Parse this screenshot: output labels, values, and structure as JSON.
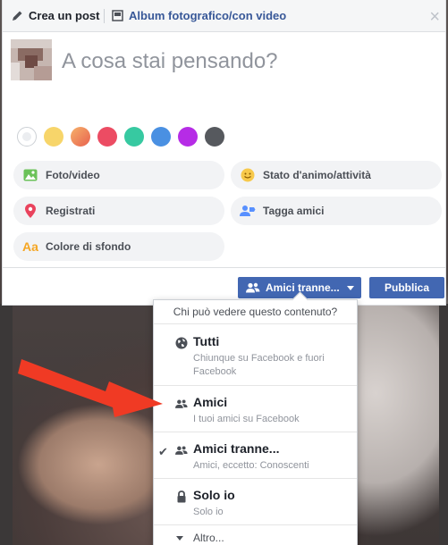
{
  "topbar": {
    "create_post_label": "Crea un post",
    "album_label": "Album fotografico/con video"
  },
  "composer": {
    "placeholder": "A cosa stai pensando?",
    "background_colors": [
      "#ffffff",
      "#f7d56a",
      "#f08a5d",
      "#ec4c63",
      "#37c9a1",
      "#4a90e2",
      "#b62ce6",
      "#56595e"
    ],
    "options": {
      "photo_video": "Foto/video",
      "feeling": "Stato d'animo/attività",
      "checkin": "Registrati",
      "tag_friends": "Tagga amici",
      "background_color": "Colore di sfondo"
    }
  },
  "actions": {
    "privacy_label": "Amici tranne...",
    "publish_label": "Pubblica"
  },
  "privacy_menu": {
    "header": "Chi può vedere questo contenuto?",
    "items": [
      {
        "title": "Tutti",
        "subtitle": "Chiunque su Facebook e fuori Facebook",
        "icon": "globe-icon",
        "selected": false
      },
      {
        "title": "Amici",
        "subtitle": "I tuoi amici su Facebook",
        "icon": "friends-icon",
        "selected": false
      },
      {
        "title": "Amici tranne...",
        "subtitle": "Amici, eccetto: Conoscenti",
        "icon": "friends-icon",
        "selected": true
      },
      {
        "title": "Solo io",
        "subtitle": "Solo io",
        "icon": "lock-icon",
        "selected": false
      }
    ],
    "more_label": "Altro..."
  },
  "colors": {
    "accent": "#4267b2",
    "arrow": "#f03a24"
  }
}
